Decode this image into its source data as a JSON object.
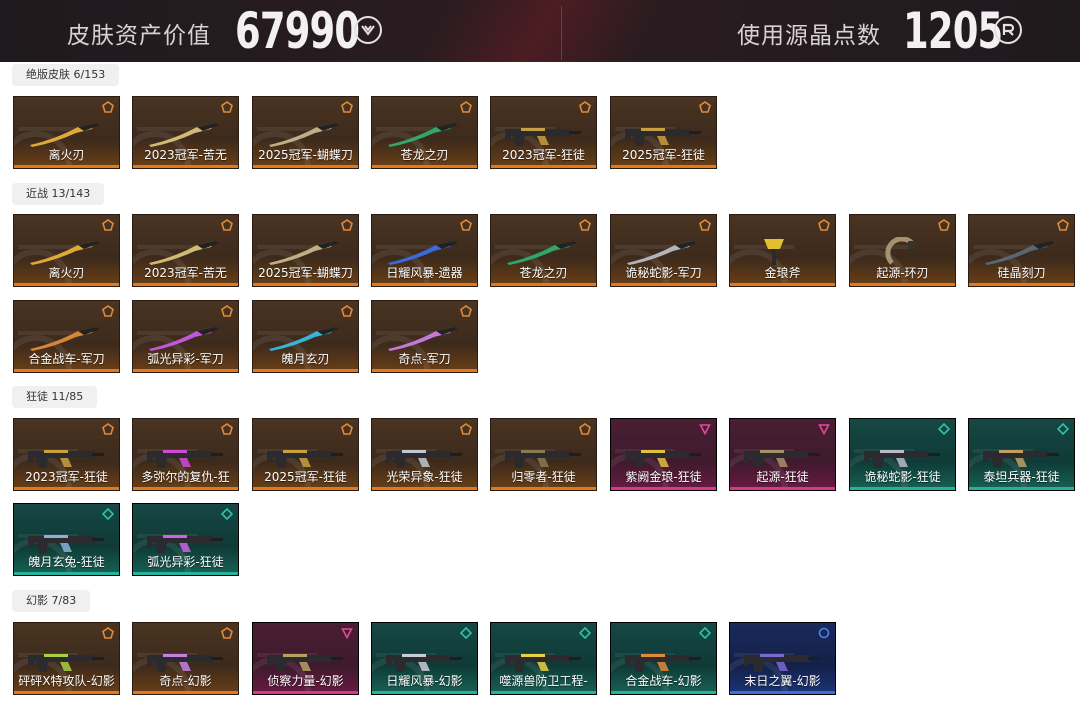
{
  "header": {
    "skin_value_label": "皮肤资产价值",
    "skin_value": "67990",
    "vp_icon": "valorant-points-icon",
    "radianite_label": "使用源晶点数",
    "radianite_value": "1205",
    "rp_icon": "radianite-points-icon"
  },
  "sections": [
    {
      "label": "绝版皮肤 6/153",
      "items": [
        {
          "name": "离火刃",
          "tier": "gold",
          "icon": "knife-icon",
          "accent": "#e8b03a"
        },
        {
          "name": "2023冠军-苦无",
          "tier": "gold",
          "icon": "kunai-icon",
          "accent": "#d9c27a"
        },
        {
          "name": "2025冠军-蝴蝶刀",
          "tier": "gold",
          "icon": "butterfly-knife-icon",
          "accent": "#c7b58a"
        },
        {
          "name": "苍龙之刃",
          "tier": "gold",
          "icon": "dragon-blade-icon",
          "accent": "#2fae6a"
        },
        {
          "name": "2023冠军-狂徒",
          "tier": "gold",
          "icon": "vandal-icon",
          "accent": "#c9a040"
        },
        {
          "name": "2025冠军-狂徒",
          "tier": "gold",
          "icon": "vandal-icon",
          "accent": "#c9a040"
        }
      ]
    },
    {
      "label": "近战 13/143",
      "items": [
        {
          "name": "离火刃",
          "tier": "gold",
          "icon": "knife-icon",
          "accent": "#e8b03a"
        },
        {
          "name": "2023冠军-苦无",
          "tier": "gold",
          "icon": "kunai-icon",
          "accent": "#d9c27a"
        },
        {
          "name": "2025冠军-蝴蝶刀",
          "tier": "gold",
          "icon": "butterfly-knife-icon",
          "accent": "#c7b58a"
        },
        {
          "name": "日耀风暴-遗器",
          "tier": "gold",
          "icon": "relic-icon",
          "accent": "#3a6ee8"
        },
        {
          "name": "苍龙之刃",
          "tier": "gold",
          "icon": "dragon-blade-icon",
          "accent": "#2fae6a"
        },
        {
          "name": "诡秘蛇影-军刀",
          "tier": "gold",
          "icon": "karambit-icon",
          "accent": "#b8bcc4"
        },
        {
          "name": "金琅斧",
          "tier": "gold",
          "icon": "axe-icon",
          "accent": "#e0c030"
        },
        {
          "name": "起源-环刃",
          "tier": "gold",
          "icon": "ring-blade-icon",
          "accent": "#a89070"
        },
        {
          "name": "硅晶刻刀",
          "tier": "gold",
          "icon": "knife-icon",
          "accent": "#5a6a78"
        },
        {
          "name": "合金战车-军刀",
          "tier": "gold",
          "icon": "karambit-icon",
          "accent": "#e08a3a"
        },
        {
          "name": "弧光异彩-军刀",
          "tier": "gold",
          "icon": "knife-icon",
          "accent": "#c85ae8"
        },
        {
          "name": "魄月玄刃",
          "tier": "gold",
          "icon": "knife-icon",
          "accent": "#3ab8e0"
        },
        {
          "name": "奇点-军刀",
          "tier": "gold",
          "icon": "knife-icon",
          "accent": "#c880e0"
        }
      ]
    },
    {
      "label": "狂徒 11/85",
      "items": [
        {
          "name": "2023冠军-狂徒",
          "tier": "gold",
          "icon": "vandal-icon",
          "accent": "#c9a040"
        },
        {
          "name": "多弥尔的复仇-狂",
          "tier": "gold",
          "icon": "vandal-icon",
          "accent": "#d04ad8"
        },
        {
          "name": "2025冠军-狂徒",
          "tier": "gold",
          "icon": "vandal-icon",
          "accent": "#c9a040"
        },
        {
          "name": "光荣异象-狂徒",
          "tier": "gold",
          "icon": "vandal-icon",
          "accent": "#c0c8d0"
        },
        {
          "name": "归零者-狂徒",
          "tier": "gold",
          "icon": "vandal-icon",
          "accent": "#8a7a50"
        },
        {
          "name": "紫阙金琅-狂徒",
          "tier": "pink",
          "icon": "vandal-icon",
          "accent": "#e0c040"
        },
        {
          "name": "起源-狂徒",
          "tier": "pink",
          "icon": "vandal-icon",
          "accent": "#a8906a"
        },
        {
          "name": "诡秘蛇影-狂徒",
          "tier": "teal",
          "icon": "vandal-icon",
          "accent": "#b8bcc4"
        },
        {
          "name": "泰坦兵器-狂徒",
          "tier": "teal",
          "icon": "vandal-icon",
          "accent": "#c0a060"
        },
        {
          "name": "魄月玄兔-狂徒",
          "tier": "teal",
          "icon": "vandal-icon",
          "accent": "#8ab0d8"
        },
        {
          "name": "弧光异彩-狂徒",
          "tier": "teal",
          "icon": "vandal-icon",
          "accent": "#d060e8"
        }
      ]
    },
    {
      "label": "幻影 7/83",
      "items": [
        {
          "name": "砰砰X特攻队-幻影",
          "tier": "gold",
          "icon": "phantom-icon",
          "accent": "#a8d040"
        },
        {
          "name": "奇点-幻影",
          "tier": "gold",
          "icon": "phantom-icon",
          "accent": "#c880e0"
        },
        {
          "name": "侦察力量-幻影",
          "tier": "pink",
          "icon": "phantom-icon",
          "accent": "#b8a060"
        },
        {
          "name": "日耀风暴-幻影",
          "tier": "teal",
          "icon": "phantom-icon",
          "accent": "#c8ccd8"
        },
        {
          "name": "噬源兽防卫工程-",
          "tier": "teal",
          "icon": "phantom-icon",
          "accent": "#e8d040"
        },
        {
          "name": "合金战车-幻影",
          "tier": "teal",
          "icon": "phantom-icon",
          "accent": "#e08a3a"
        },
        {
          "name": "末日之翼-幻影",
          "tier": "blue",
          "icon": "phantom-icon",
          "accent": "#7a6ad0"
        }
      ]
    }
  ]
}
